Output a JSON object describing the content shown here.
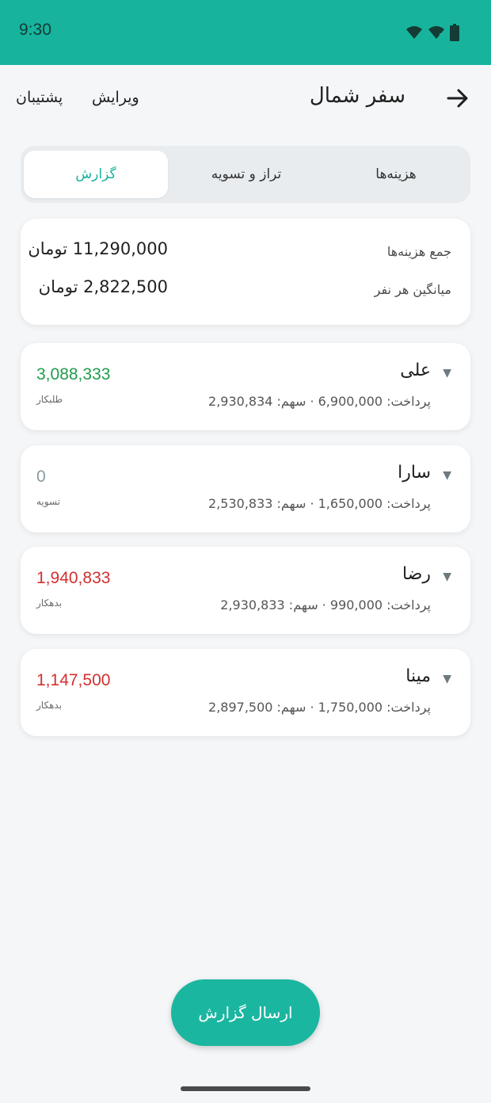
{
  "status_bar": {
    "time": "9:30",
    "icons": [
      "wifi-icon",
      "signal-icon",
      "battery-icon"
    ]
  },
  "app_bar": {
    "title": "سفر شمال",
    "back_icon": "arrow-right-icon",
    "actions": {
      "edit": "ویرایش",
      "support": "پشتیبان"
    }
  },
  "tabs": {
    "expenses": "هزینه‌ها",
    "settle": "تراز و تسویه",
    "report": "گزارش",
    "active": "report"
  },
  "summary": {
    "total_label": "جمع هزینه‌ها",
    "total_value": "11,290,000 تومان",
    "avg_label": "میانگین هر نفر",
    "avg_value": "2,822,500 تومان"
  },
  "people": [
    {
      "name": "علی",
      "detail": "پرداخت: 6,900,000 · سهم: 2,930,834",
      "balance": "3,088,333",
      "status": "طلبکار",
      "color": "#1f9d4c"
    },
    {
      "name": "سارا",
      "detail": "پرداخت: 1,650,000 · سهم: 2,530,833",
      "balance": "0",
      "status": "تسویه",
      "color": "#8a9aa1"
    },
    {
      "name": "رضا",
      "detail": "پرداخت: 990,000 · سهم: 2,930,833",
      "balance": "1,940,833",
      "status": "بدهکار",
      "color": "#d32f2f"
    },
    {
      "name": "مینا",
      "detail": "پرداخت: 1,750,000 · سهم: 2,897,500",
      "balance": "1,147,500",
      "status": "بدهکار",
      "color": "#d32f2f"
    }
  ],
  "caret": "▼",
  "fab": {
    "label": "ارسال گزارش"
  },
  "colors": {
    "accent": "#17b39d",
    "background": "#f4f6f8"
  }
}
